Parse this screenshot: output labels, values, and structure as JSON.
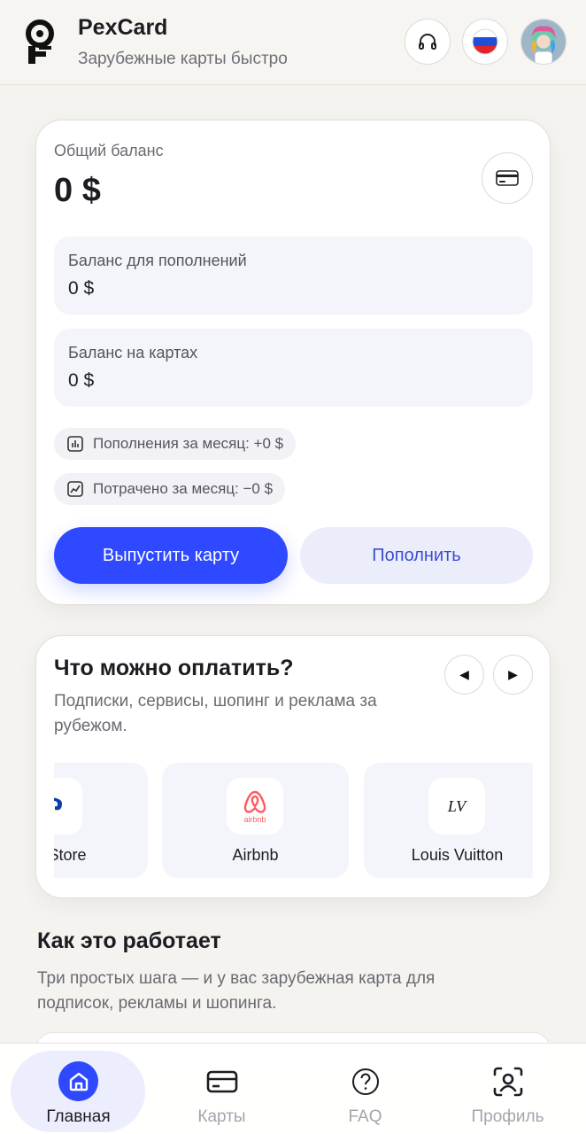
{
  "header": {
    "brand": "PexCard",
    "tagline": "Зарубежные карты быстро",
    "support_icon": "headphones-icon",
    "language_icon": "russia-flag-icon",
    "avatar_icon": "user-avatar"
  },
  "balance": {
    "label": "Общий баланс",
    "value": "0 $",
    "card_icon": "credit-card-icon",
    "topup_balance": {
      "label": "Баланс для пополнений",
      "value": "0 $"
    },
    "cards_balance": {
      "label": "Баланс на картах",
      "value": "0 $"
    },
    "month_topups": "Пополнения за месяц: +0 $",
    "month_spent": "Потрачено за месяц: −0 $",
    "issue_button": "Выпустить карту",
    "topup_button": "Пополнить"
  },
  "payments": {
    "title": "Что можно оплатить?",
    "subtitle": "Подписки, сервисы, шопинг и реклама за рубежом.",
    "prev_label": "◀",
    "next_label": "▶",
    "items": [
      {
        "name": "ion Store",
        "icon": "playstation-icon"
      },
      {
        "name": "Airbnb",
        "icon": "airbnb-icon",
        "icon_text": "airbnb"
      },
      {
        "name": "Louis Vuitton",
        "icon": "louis-vuitton-icon",
        "icon_text": "LV"
      }
    ]
  },
  "how": {
    "title": "Как это работает",
    "subtitle": "Три простых шага — и у вас зарубежная карта для подписок, рекламы и шопинга."
  },
  "nav": {
    "items": [
      {
        "label": "Главная",
        "icon": "home-icon",
        "active": true
      },
      {
        "label": "Карты",
        "icon": "card-icon",
        "active": false
      },
      {
        "label": "FAQ",
        "icon": "question-icon",
        "active": false
      },
      {
        "label": "Профиль",
        "icon": "profile-icon",
        "active": false
      }
    ]
  },
  "colors": {
    "accent": "#2e49ff",
    "background": "#f5f3ef",
    "subtle_surface": "#f4f4fb"
  }
}
